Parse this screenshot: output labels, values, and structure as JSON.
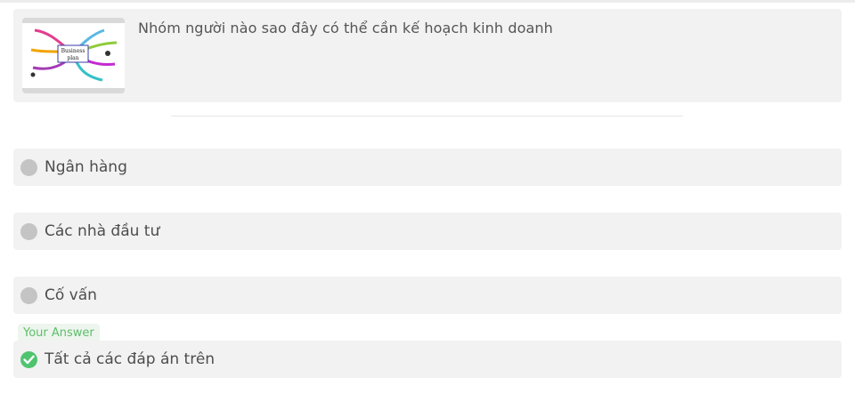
{
  "question": {
    "text": "Nhóm người nào sao đây có thể cần kế hoạch kinh doanh",
    "image_label_line1": "Business",
    "image_label_line2": "plan"
  },
  "answer_tag": "Your Answer",
  "options": [
    {
      "label": "Ngân hàng",
      "selected": false
    },
    {
      "label": "Các nhà đầu tư",
      "selected": false
    },
    {
      "label": "Cố vấn",
      "selected": false
    },
    {
      "label": "Tất cả các đáp án trên",
      "selected": true
    }
  ],
  "colors": {
    "card_bg": "#f2f2f2",
    "radio_unselected": "#c4c4c4",
    "radio_selected": "#4fc46f",
    "answer_tag_text": "#5cbf6a"
  },
  "icons": {
    "radio_unselected": "radio-icon",
    "radio_selected": "check-circle-icon"
  }
}
